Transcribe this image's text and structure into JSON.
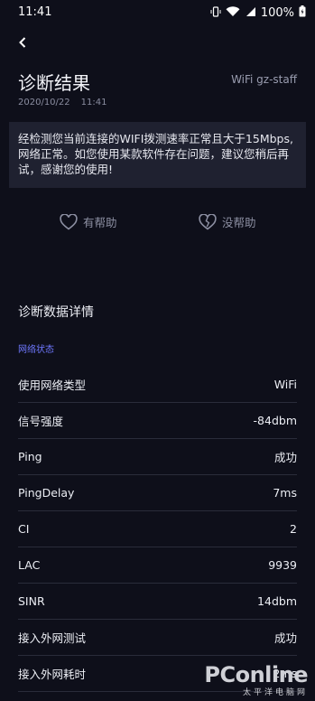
{
  "status": {
    "time": "11:41",
    "battery": "100%"
  },
  "header": {
    "title": "诊断结果",
    "wifi_name": "WiFi gz-staff",
    "date": "2020/10/22",
    "time": "11:41"
  },
  "result": {
    "message": "经检测您当前连接的WIFI拨测速率正常且大于15Mbps,网络正常。如您使用某款软件存在问题，建议您稍后再试，感谢您的使用!"
  },
  "feedback": {
    "helpful": "有帮助",
    "not_helpful": "没帮助"
  },
  "details": {
    "title": "诊断数据详情",
    "section": "网络状态",
    "rows": [
      {
        "label": "使用网络类型",
        "value": "WiFi"
      },
      {
        "label": "信号强度",
        "value": "-84dbm"
      },
      {
        "label": "Ping",
        "value": "成功"
      },
      {
        "label": "PingDelay",
        "value": "7ms"
      },
      {
        "label": "CI",
        "value": "2"
      },
      {
        "label": "LAC",
        "value": "9939"
      },
      {
        "label": "SINR",
        "value": "14dbm"
      },
      {
        "label": "接入外网测试",
        "value": "成功"
      },
      {
        "label": "接入外网耗时",
        "value": "2ms"
      }
    ]
  },
  "watermark": {
    "main": "PConline",
    "sub": "太平洋电脑网"
  }
}
